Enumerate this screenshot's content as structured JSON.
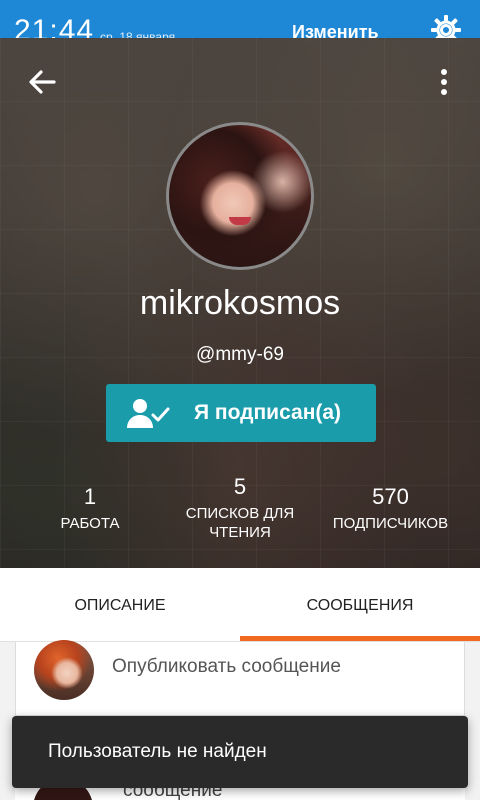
{
  "status_bar": {
    "time": "21:44",
    "date": "ср, 18 января",
    "edit_label": "Изменить",
    "settings_icon": "gear-icon"
  },
  "header": {
    "back_icon": "arrow-left-icon",
    "more_icon": "more-vertical-icon"
  },
  "profile": {
    "username": "mikrokosmos",
    "handle": "@mmy-69",
    "follow_button": {
      "label": "Я подписан(а)",
      "icon": "user-check-icon",
      "color": "#1a9cab"
    },
    "stats": [
      {
        "value": "1",
        "label": "Работа"
      },
      {
        "value": "5",
        "label": "Списков для чтения"
      },
      {
        "value": "570",
        "label": "Подписчиков"
      }
    ]
  },
  "tabs": [
    {
      "label": "Описание",
      "selected": false
    },
    {
      "label": "Сообщения",
      "selected": true
    }
  ],
  "accent_color": "#f26a22",
  "messages": {
    "compose_placeholder": "Опубликовать сообщение",
    "next_item_text": "сообщение"
  },
  "toast": {
    "text": "Пользователь не найден"
  }
}
